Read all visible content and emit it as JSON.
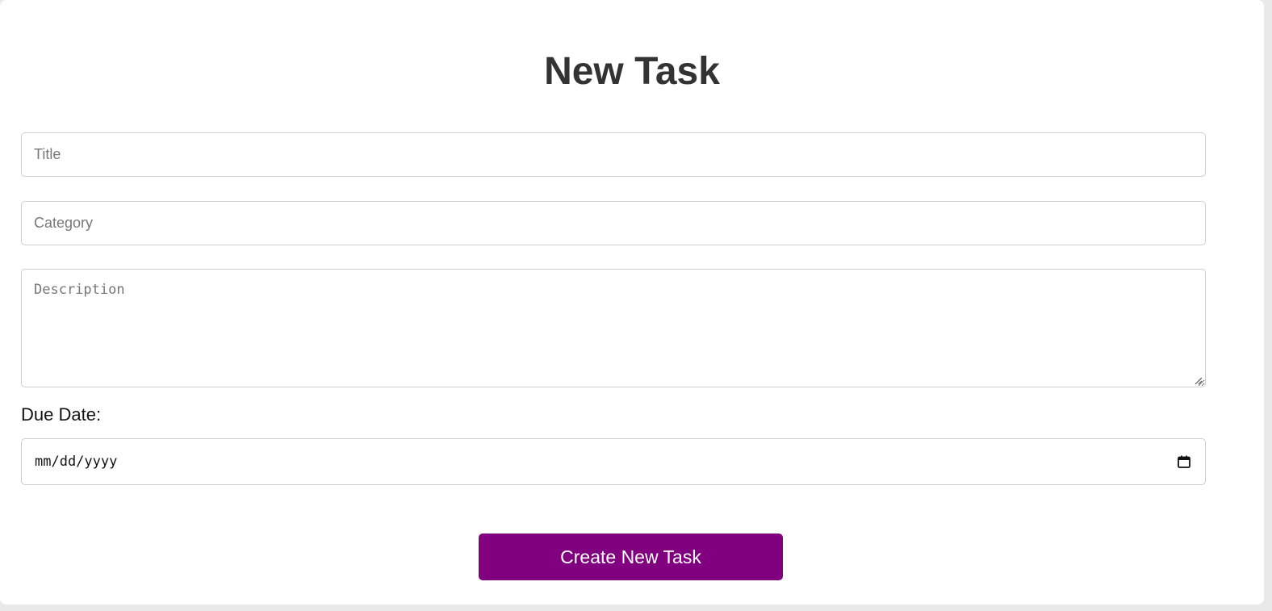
{
  "form": {
    "heading": "New Task",
    "title_placeholder": "Title",
    "category_placeholder": "Category",
    "description_placeholder": "Description",
    "due_date_label": "Due Date:",
    "due_date_placeholder": "mm/dd/yyyy",
    "submit_label": "Create New Task"
  },
  "icons": {
    "date_picker": "calendar-icon",
    "textarea_resize": "resize-grip-icon"
  },
  "colors": {
    "accent": "#800080",
    "heading": "#333333",
    "border": "#cfcfcf",
    "background": "#ffffff",
    "page_background": "#e9e9e9"
  }
}
